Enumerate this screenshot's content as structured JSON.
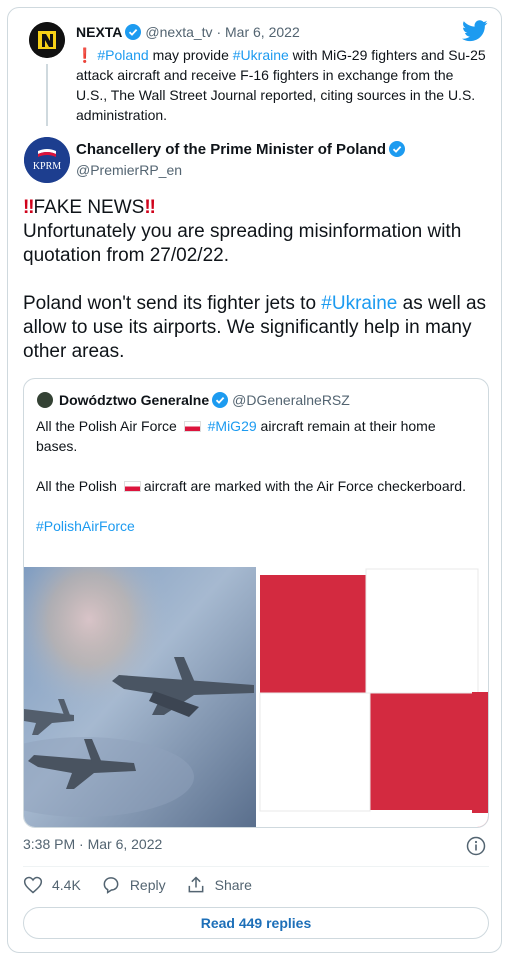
{
  "parent_tweet": {
    "name": "NEXTA",
    "handle": "@nexta_tv",
    "date": "Mar 6, 2022",
    "text_parts": [
      "❗",
      "#Poland",
      " may provide ",
      "#Ukraine",
      " with MiG-29 fighters and Su-25 attack aircraft and receive F-16 fighters in exchange from the U.S., The Wall Street Journal reported, citing sources in the U.S. administration."
    ]
  },
  "main_tweet": {
    "avatar_text": "KPRM",
    "name": "Chancellery of the Prime Minister of Poland",
    "handle": "@PremierRP_en",
    "excl1": "‼",
    "headline": "FAKE NEWS",
    "excl2": "‼",
    "line2": "Unfortunately you are spreading misinformation with quotation from 27/02/22.",
    "p2_before": "Poland won't send its fighter jets to ",
    "p2_hashtag": "#Ukraine",
    "p2_after": " as well as allow to use its airports. We significantly help in many other areas."
  },
  "quoted_tweet": {
    "name": "Dowództwo Generalne",
    "handle": "@DGeneralneRSZ",
    "l1_a": "All the Polish Air Force",
    "l1_hashtag": "#MiG29",
    "l1_b": " aircraft remain at their home bases.",
    "l2_a": "All the Polish",
    "l2_b": "aircraft are marked with the Air Force checkerboard.",
    "hashtag": "#PolishAirForce"
  },
  "meta": {
    "time": "3:38 PM · Mar 6, 2022"
  },
  "actions": {
    "likes": "4.4K",
    "reply_label": "Reply",
    "share_label": "Share"
  },
  "read_replies": "Read 449 replies",
  "colors": {
    "accent": "#1d9bf0",
    "polish_red": "#dc143c"
  },
  "icons": [
    "twitter-bird-icon",
    "verified-icon",
    "heart-icon",
    "reply-icon",
    "share-icon",
    "info-icon"
  ]
}
